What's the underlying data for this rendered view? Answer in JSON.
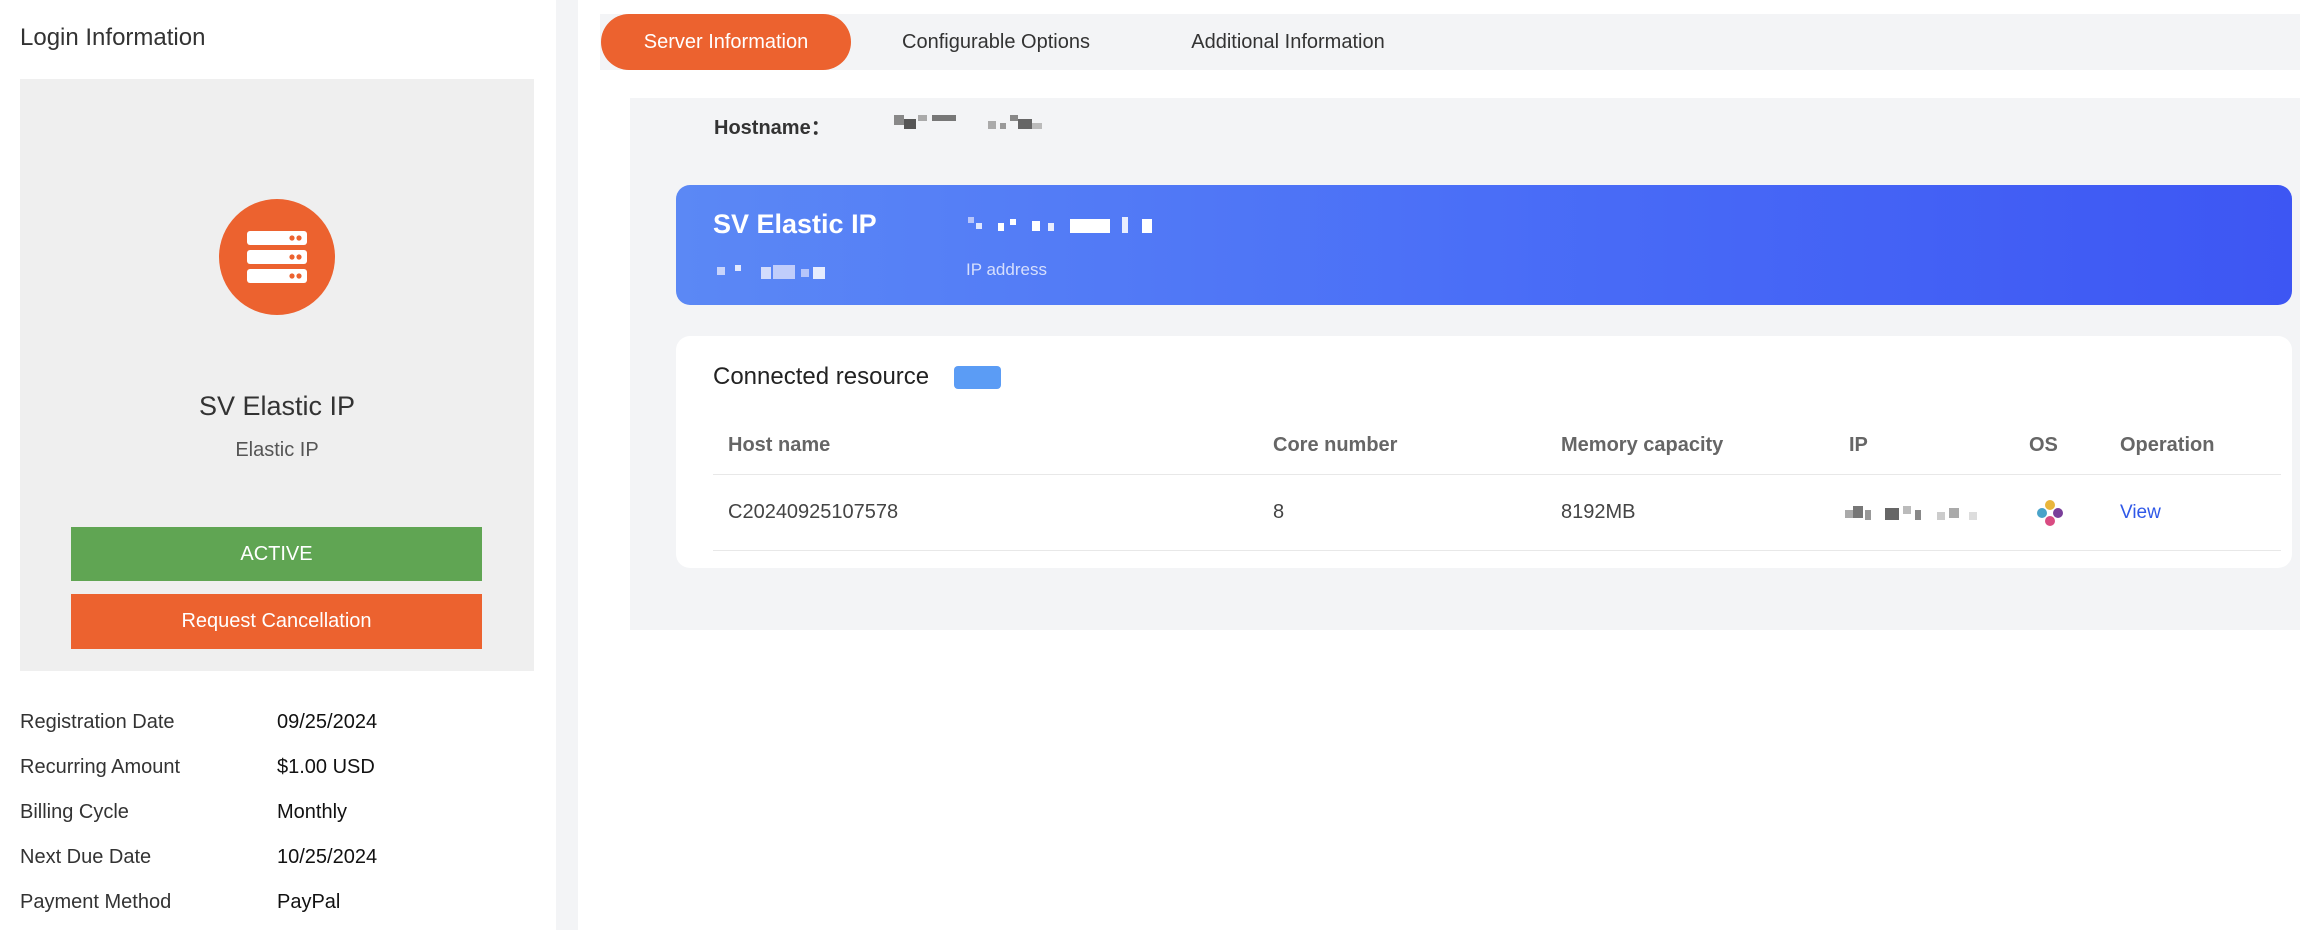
{
  "left": {
    "title": "Login Information",
    "product": {
      "name": "SV Elastic IP",
      "type": "Elastic IP",
      "icon": "server-icon",
      "status_label": "ACTIVE",
      "cancel_label": "Request Cancellation"
    },
    "info": [
      {
        "label": "Registration Date",
        "value": "09/25/2024"
      },
      {
        "label": "Recurring Amount",
        "value": "$1.00 USD"
      },
      {
        "label": "Billing Cycle",
        "value": "Monthly"
      },
      {
        "label": "Next Due Date",
        "value": "10/25/2024"
      },
      {
        "label": "Payment Method",
        "value": "PayPal"
      }
    ]
  },
  "tabs": [
    {
      "label": "Server Information",
      "active": true
    },
    {
      "label": "Configurable Options",
      "active": false
    },
    {
      "label": "Additional Information",
      "active": false
    }
  ],
  "server": {
    "hostname_label": "Hostname："
  },
  "ip_card": {
    "title": "SV Elastic IP",
    "caption": "IP address"
  },
  "resource": {
    "title": "Connected resource",
    "columns": [
      "Host name",
      "Core number",
      "Memory capacity",
      "IP",
      "OS",
      "Operation"
    ],
    "rows": [
      {
        "host": "C20240925107578",
        "cores": "8",
        "memory": "8192MB",
        "os_icon": "os-logo-icon",
        "operation": "View"
      }
    ]
  },
  "colors": {
    "accent": "#ec622f",
    "active": "#60a553",
    "ip_card_gradient_start": "#5b88f5",
    "ip_card_gradient_end": "#3d56f3",
    "link": "#2f58e8"
  }
}
